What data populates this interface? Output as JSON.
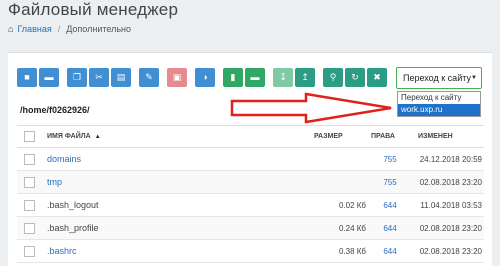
{
  "page": {
    "title": "Файловый менеджер"
  },
  "breadcrumb": {
    "home_label": "Главная",
    "separator": "/",
    "current": "Дополнительно"
  },
  "toolbar": {
    "buttons": [
      {
        "icon": "upload-icon",
        "color": "#3f8fd2"
      },
      {
        "icon": "folder-icon",
        "color": "#3f8fd2"
      },
      {
        "icon": "copy-icon",
        "color": "#3f8fd2"
      },
      {
        "icon": "cut-icon",
        "color": "#3f8fd2"
      },
      {
        "icon": "paste-icon",
        "color": "#3f8fd2"
      },
      {
        "icon": "edit-icon",
        "color": "#3f8fd2"
      },
      {
        "icon": "delete-icon",
        "color": "#e68a8f"
      },
      {
        "icon": "permissions-icon",
        "color": "#3f8fd2"
      },
      {
        "icon": "new-file-icon",
        "color": "#2fa865"
      },
      {
        "icon": "new-folder-icon",
        "color": "#2fa865"
      },
      {
        "icon": "download-icon",
        "color": "#7fc9a3"
      },
      {
        "icon": "upload-file-icon",
        "color": "#2a9d84"
      },
      {
        "icon": "search-icon",
        "color": "#2a9d84"
      },
      {
        "icon": "refresh-icon",
        "color": "#2a9d84"
      },
      {
        "icon": "expand-icon",
        "color": "#2a9d84"
      }
    ]
  },
  "site_select": {
    "value": "Переход к сайту",
    "options": [
      "Переход к сайту",
      "work.uxp.ru"
    ],
    "highlighted": "work.uxp.ru"
  },
  "current_path": "/home/f0262926/",
  "table": {
    "headers": {
      "name": "ИМЯ ФАЙЛА",
      "size": "РАЗМЕР",
      "perm": "ПРАВА",
      "modified": "ИЗМЕНЕН"
    },
    "rows": [
      {
        "name": "domains",
        "type": "dir",
        "size": "",
        "perm": "755",
        "modified": "24.12.2018 20:59"
      },
      {
        "name": "tmp",
        "type": "dir",
        "size": "",
        "perm": "755",
        "modified": "02.08.2018 23:20"
      },
      {
        "name": ".bash_logout",
        "type": "file",
        "size": "0.02 Кб",
        "perm": "644",
        "modified": "11.04.2018 03:53"
      },
      {
        "name": ".bash_profile",
        "type": "file",
        "size": "0.24 Кб",
        "perm": "644",
        "modified": "02.08.2018 23:20"
      },
      {
        "name": ".bashrc",
        "type": "dir",
        "size": "0.38 Кб",
        "perm": "644",
        "modified": "02.08.2018 23:20"
      }
    ]
  },
  "colors": {
    "accent_blue": "#3f8fd2",
    "accent_green": "#2fa865",
    "arrow_red": "#e0201c",
    "link": "#2a6ebb"
  }
}
